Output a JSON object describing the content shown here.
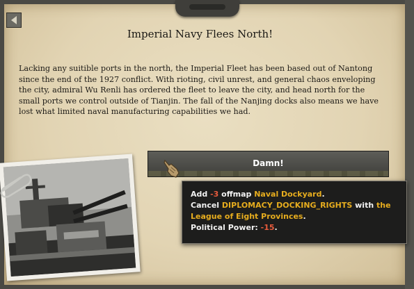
{
  "event": {
    "title": "Imperial Navy Flees North!",
    "description": "Lacking any suitible ports in the north, the Imperial Fleet has been based out of Nantong since the end of the 1927 conflict. With rioting, civil unrest, and general chaos enveloping the city, admiral Wu Renli has ordered the fleet to leave the city, and head north for the small ports we control outside of Tianjin. The fall of the Nanjing docks also means we have lost what limited naval manufacturing capabilities we had.",
    "option_label": "Damn!",
    "back_icon": "back-arrow-icon",
    "pointer_icon": "gauntlet-pointer-icon"
  },
  "tooltip": {
    "line1": {
      "prefix": "Add ",
      "value": "-3",
      "middle": " offmap ",
      "target": "Naval Dockyard",
      "suffix": "."
    },
    "line2": {
      "prefix": "Cancel ",
      "decision": "DIPLOMACY_DOCKING_RIGHTS",
      "middle": " with ",
      "target": "the League of Eight Provinces",
      "suffix": "."
    },
    "line3": {
      "prefix": "Political Power: ",
      "value": "-15",
      "suffix": "."
    }
  },
  "colors": {
    "highlight": "#e7ad1e",
    "negative": "#e85b3c",
    "paper": "#e2d4b3",
    "tooltip_bg": "#1d1d1c"
  }
}
